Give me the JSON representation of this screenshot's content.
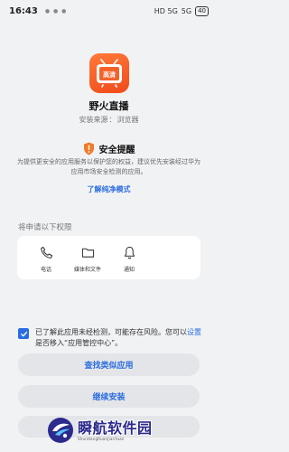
{
  "status_bar": {
    "time": "16:43",
    "signal": "HD 5G",
    "wifi": "5G",
    "battery": "40"
  },
  "app": {
    "icon_label": "高清",
    "name": "野火直播",
    "source_label": "安装来源",
    "source_value": "浏览器",
    "icon_colors": [
      "#ff7a3a",
      "#f04a1a"
    ]
  },
  "security": {
    "title": "安全提醒",
    "description": "为提供更安全的应用服务以保护您的权益，建议优先安装经过华为应用市场安全检测的应用。",
    "pure_mode_link": "了解纯净模式",
    "shield_color": "#f07b2a"
  },
  "permissions": {
    "heading": "将申请以下权限",
    "items": [
      {
        "label": "电话",
        "icon": "phone-icon"
      },
      {
        "label": "媒体和文件",
        "icon": "folder-icon"
      },
      {
        "label": "通知",
        "icon": "bell-icon"
      }
    ]
  },
  "consent": {
    "checked": true,
    "text_before": "已了解此应用未经检测，可能存在风险。您可以",
    "link": "设置",
    "text_after": "是否移入“应用管控中心”。"
  },
  "buttons": {
    "find_similar": "查找类似应用",
    "continue_install": "继续安装"
  },
  "watermark": {
    "title": "瞬航软件园",
    "subtitle": "ShunHangRuanJianYuan"
  },
  "accent_color": "#2b6de0"
}
